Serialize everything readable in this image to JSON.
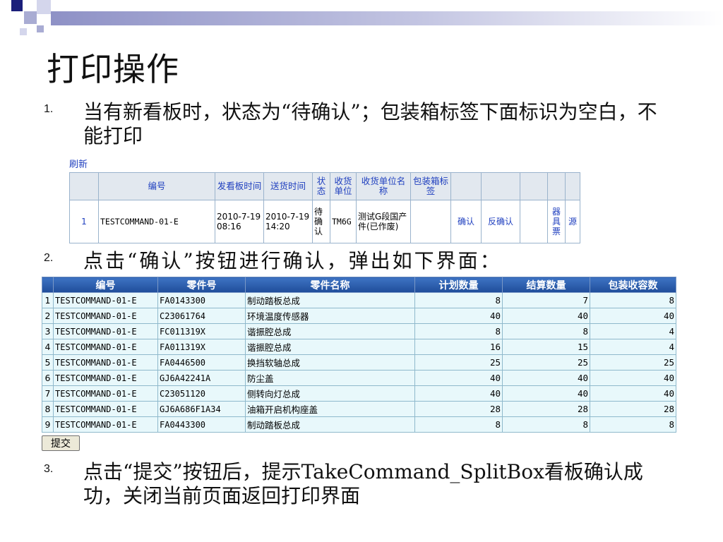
{
  "title": "打印操作",
  "steps": [
    {
      "number": "1.",
      "text": "当有新看板时，状态为“待确认”；包装箱标签下面标识为空白，不能打印"
    },
    {
      "number": "2.",
      "text": "点击“确认”按钮进行确认，弹出如下界面："
    },
    {
      "number": "3.",
      "text": "点击“提交”按钮后，提示TakeCommand_SplitBox看板确认成功，关闭当前页面返回打印界面"
    }
  ],
  "kanban_screen": {
    "refresh_label": "刷新",
    "headers": [
      "",
      "编号",
      "发看板时间",
      "送货时间",
      "状态",
      "收货单位",
      "收货单位名称",
      "包装箱标签",
      "",
      "",
      "",
      "",
      ""
    ],
    "row": {
      "index": "1",
      "code": "TESTCOMMAND-01-E",
      "issue_time": "2010-7-19 08:16",
      "delivery_time": "2010-7-19 14:20",
      "status": "待确认",
      "receiver": "TM6G",
      "receiver_name": "测试G段国产件(已作废)",
      "box_label": "",
      "confirm_link": "确认",
      "unconfirm_link": "反确认",
      "ticket_link": "器具票",
      "source_link": "源"
    }
  },
  "parts_screen": {
    "headers": [
      "",
      "编号",
      "零件号",
      "零件名称",
      "计划数量",
      "结算数量",
      "包装收容数"
    ],
    "rows": [
      {
        "idx": "1",
        "code": "TESTCOMMAND-01-E",
        "part_no": "FA0143300",
        "part_name": "制动踏板总成",
        "plan": "8",
        "settle": "7",
        "pack": "8"
      },
      {
        "idx": "2",
        "code": "TESTCOMMAND-01-E",
        "part_no": "C23061764",
        "part_name": "环境温度传感器",
        "plan": "40",
        "settle": "40",
        "pack": "40"
      },
      {
        "idx": "3",
        "code": "TESTCOMMAND-01-E",
        "part_no": "FC011319X",
        "part_name": "谐振腔总成",
        "plan": "8",
        "settle": "8",
        "pack": "4"
      },
      {
        "idx": "4",
        "code": "TESTCOMMAND-01-E",
        "part_no": "FA011319X",
        "part_name": "谐振腔总成",
        "plan": "16",
        "settle": "15",
        "pack": "4"
      },
      {
        "idx": "5",
        "code": "TESTCOMMAND-01-E",
        "part_no": "FA0446500",
        "part_name": "换挡软轴总成",
        "plan": "25",
        "settle": "25",
        "pack": "25"
      },
      {
        "idx": "6",
        "code": "TESTCOMMAND-01-E",
        "part_no": "GJ6A42241A",
        "part_name": "防尘盖",
        "plan": "40",
        "settle": "40",
        "pack": "40"
      },
      {
        "idx": "7",
        "code": "TESTCOMMAND-01-E",
        "part_no": "C23051120",
        "part_name": "侧转向灯总成",
        "plan": "40",
        "settle": "40",
        "pack": "40"
      },
      {
        "idx": "8",
        "code": "TESTCOMMAND-01-E",
        "part_no": "GJ6A686F1A34",
        "part_name": "油箱开启机构座盖",
        "plan": "28",
        "settle": "28",
        "pack": "28"
      },
      {
        "idx": "9",
        "code": "TESTCOMMAND-01-E",
        "part_no": "FA0443300",
        "part_name": "制动踏板总成",
        "plan": "8",
        "settle": "8",
        "pack": "8"
      }
    ],
    "submit_label": "提交"
  }
}
